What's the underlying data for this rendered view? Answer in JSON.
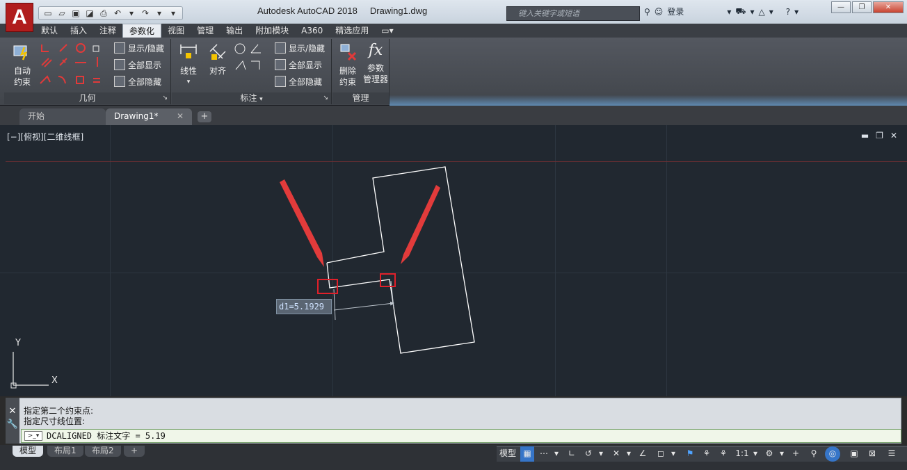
{
  "app": {
    "logo_letter": "A",
    "title": "Autodesk AutoCAD 2018",
    "filename": "Drawing1.dwg",
    "search_placeholder": "键入关键字或短语",
    "login_label": "登录",
    "help_label": "?"
  },
  "ribbon_tabs": [
    "默认",
    "插入",
    "注释",
    "参数化",
    "视图",
    "管理",
    "输出",
    "附加模块",
    "A360",
    "精选应用"
  ],
  "active_ribbon_tab": "参数化",
  "panels": {
    "geometry": {
      "title": "几何",
      "auto_constrain_l1": "自动",
      "auto_constrain_l2": "约束",
      "show_hide": "显示/隐藏",
      "show_all": "全部显示",
      "hide_all": "全部隐藏"
    },
    "dimensional": {
      "title": "标注",
      "linear": "线性",
      "aligned": "对齐",
      "show_hide": "显示/隐藏",
      "show_all": "全部显示",
      "hide_all": "全部隐藏"
    },
    "manage": {
      "title": "管理",
      "delete_l1": "删除",
      "delete_l2": "约束",
      "params_l1": "参数",
      "params_l2": "管理器",
      "fx": "fx"
    }
  },
  "doc_tabs": [
    {
      "label": "开始"
    },
    {
      "label": "Drawing1*"
    }
  ],
  "viewport": {
    "label": "[−][俯视][二维线框]",
    "dim_tooltip": "d1=5.1929",
    "ucs_y": "Y",
    "ucs_x": "X"
  },
  "command": {
    "history": [
      "指定第二个约束点:",
      "指定尺寸线位置:"
    ],
    "current": "DCALIGNED 标注文字 = 5.19"
  },
  "layout_tabs": [
    "模型",
    "布局1",
    "布局2"
  ],
  "status": {
    "model_label": "模型",
    "scale": "1:1"
  },
  "colors": {
    "canvas_bg": "#212830",
    "arrow_red": "#e23b3b",
    "highlight_red": "#e0202a",
    "accent_blue": "#3675c8"
  }
}
